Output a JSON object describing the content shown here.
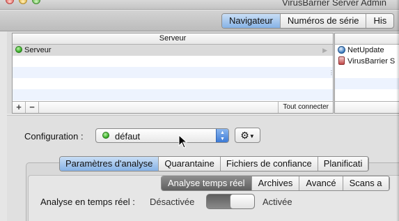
{
  "window": {
    "title": "VirusBarrier Server Admin"
  },
  "toolbar": {
    "tabs": [
      {
        "label": "Navigateur",
        "active": true
      },
      {
        "label": "Numéros de série",
        "active": false
      },
      {
        "label": "His",
        "active": false
      }
    ]
  },
  "server_list": {
    "header": "Serveur",
    "rows": [
      {
        "label": "Serveur",
        "status": "green"
      }
    ],
    "footer": {
      "add": "+",
      "remove": "−",
      "connect_all": "Tout connecter"
    }
  },
  "product_list": {
    "items": [
      {
        "label": "NetUpdate",
        "icon": "netupdate-icon"
      },
      {
        "label": "VirusBarrier S",
        "icon": "virusbarrier-icon"
      }
    ]
  },
  "configuration": {
    "label": "Configuration :",
    "value": "défaut",
    "gear_icon": "gear-icon"
  },
  "main_tabs": [
    {
      "label": "Paramètres d'analyse",
      "active": true
    },
    {
      "label": "Quarantaine",
      "active": false
    },
    {
      "label": "Fichiers de confiance",
      "active": false
    },
    {
      "label": "Planificati",
      "active": false
    }
  ],
  "sub_tabs": [
    {
      "label": "Analyse temps réel",
      "active": true
    },
    {
      "label": "Archives",
      "active": false
    },
    {
      "label": "Avancé",
      "active": false
    },
    {
      "label": "Scans a",
      "active": false
    }
  ],
  "realtime": {
    "label": "Analyse en temps réel :",
    "off_label": "Désactivée",
    "on_label": "Activée",
    "enabled": true
  },
  "colors": {
    "accent": "#86b2e6",
    "status_green": "#2ea51c"
  }
}
